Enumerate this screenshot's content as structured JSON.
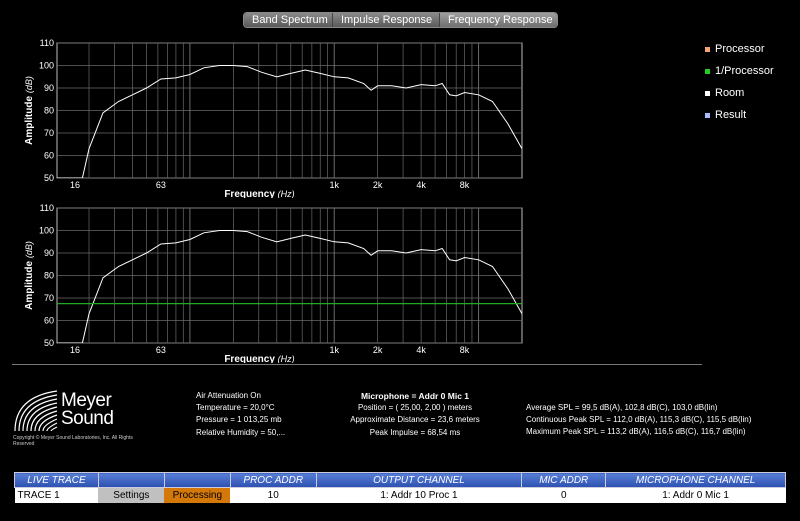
{
  "tabs": [
    "Band Spectrum",
    "Impulse Response",
    "Frequency Response"
  ],
  "legend": [
    {
      "label": "Processor",
      "color": "#f4a37a"
    },
    {
      "label": "1/Processor",
      "color": "#22cc22"
    },
    {
      "label": "Room",
      "color": "#ffffff"
    },
    {
      "label": "Result",
      "color": "#aab8ff"
    }
  ],
  "chart_data": [
    {
      "type": "line",
      "xlabel": "Frequency",
      "xunit": "(Hz)",
      "ylabel": "Amplitude",
      "yunit": "(dB)",
      "x_scale": "log",
      "xlim": [
        12,
        20000
      ],
      "ylim": [
        50,
        110
      ],
      "x_tick_labels": [
        "16",
        "63",
        "1k",
        "2k",
        "4k",
        "8k"
      ],
      "x_tick_values": [
        16,
        63,
        1000,
        2000,
        4000,
        8000
      ],
      "y_ticks": [
        50,
        60,
        70,
        80,
        90,
        100,
        110
      ],
      "grid": true,
      "series": [
        {
          "color": "#ffffff",
          "x": [
            12,
            18,
            20,
            25,
            32,
            40,
            50,
            63,
            80,
            100,
            125,
            160,
            200,
            250,
            315,
            400,
            500,
            630,
            800,
            1000,
            1250,
            1600,
            1800,
            2000,
            2500,
            3150,
            4000,
            5000,
            5600,
            6300,
            7000,
            8000,
            10000,
            12500,
            16000,
            20000
          ],
          "y": [
            50,
            50,
            63,
            79,
            84,
            87,
            90,
            94,
            94.5,
            96,
            99,
            100,
            100,
            99.5,
            97,
            95,
            96.5,
            98,
            96.5,
            95,
            94.5,
            92,
            89,
            91,
            91,
            90,
            91.5,
            91,
            92,
            87,
            86.5,
            88,
            87,
            84,
            74,
            63
          ]
        }
      ]
    },
    {
      "type": "line",
      "xlabel": "Frequency",
      "xunit": "(Hz)",
      "ylabel": "Amplitude",
      "yunit": "(dB)",
      "x_scale": "log",
      "xlim": [
        12,
        20000
      ],
      "ylim": [
        50,
        110
      ],
      "x_tick_labels": [
        "16",
        "63",
        "1k",
        "2k",
        "4k",
        "8k"
      ],
      "x_tick_values": [
        16,
        63,
        1000,
        2000,
        4000,
        8000
      ],
      "y_ticks": [
        50,
        60,
        70,
        80,
        90,
        100,
        110
      ],
      "grid": true,
      "series": [
        {
          "color": "#ffffff",
          "x": [
            12,
            18,
            20,
            25,
            32,
            40,
            50,
            63,
            80,
            100,
            125,
            160,
            200,
            250,
            315,
            400,
            500,
            630,
            800,
            1000,
            1250,
            1600,
            1800,
            2000,
            2500,
            3150,
            4000,
            5000,
            5600,
            6300,
            7000,
            8000,
            10000,
            12500,
            16000,
            20000
          ],
          "y": [
            50,
            50,
            63,
            79,
            84,
            87,
            90,
            94,
            94.5,
            96,
            99,
            100,
            100,
            99.5,
            97,
            95,
            96.5,
            98,
            96.5,
            95,
            94.5,
            92,
            89,
            91,
            91,
            90,
            91.5,
            91,
            92,
            87,
            86.5,
            88,
            87,
            84,
            74,
            63
          ]
        },
        {
          "color": "#22aa22",
          "x": [
            12,
            20000
          ],
          "y": [
            67.5,
            67.5
          ]
        }
      ]
    }
  ],
  "logo": {
    "name": "Meyer Sound",
    "copyright": "Copyright © Meyer Sound Laboratories, Inc. All Rights Reserved"
  },
  "atmosphere": {
    "line1": "Air Attenuation On",
    "line2": "Temperature = 20,0°C",
    "line3": "Pressure = 1 013,25  mb",
    "line4": "Relative Humidity = 50,..."
  },
  "microphone": {
    "title": "Microphone = Addr 0 Mic 1",
    "position": "Position = ( 25,00, 2,00 ) meters",
    "distance": "Approximate Distance = 23,6 meters",
    "impulse": "Peak Impulse = 68,54 ms"
  },
  "spl": {
    "average": "Average SPL = 99,5 dB(A),  102,8 dB(C),  103,0 dB(lin)",
    "continuous": "Continuous Peak SPL = 112,0 dB(A),  115,3 dB(C),  115,5 dB(lin)",
    "maximum": "Maximum Peak SPL = 113,2 dB(A),  116,5 dB(C),  116,7 dB(lin)"
  },
  "table": {
    "headers": [
      "LIVE TRACE",
      "",
      "",
      "PROC ADDR",
      "OUTPUT CHANNEL",
      "MIC ADDR",
      "MICROPHONE CHANNEL"
    ],
    "row": {
      "trace": "TRACE 1",
      "settings": "Settings",
      "processing": "Processing",
      "proc_addr": "10",
      "output_channel": "1: Addr 10 Proc 1",
      "mic_addr": "0",
      "mic_channel": "1: Addr 0 Mic 1"
    }
  }
}
